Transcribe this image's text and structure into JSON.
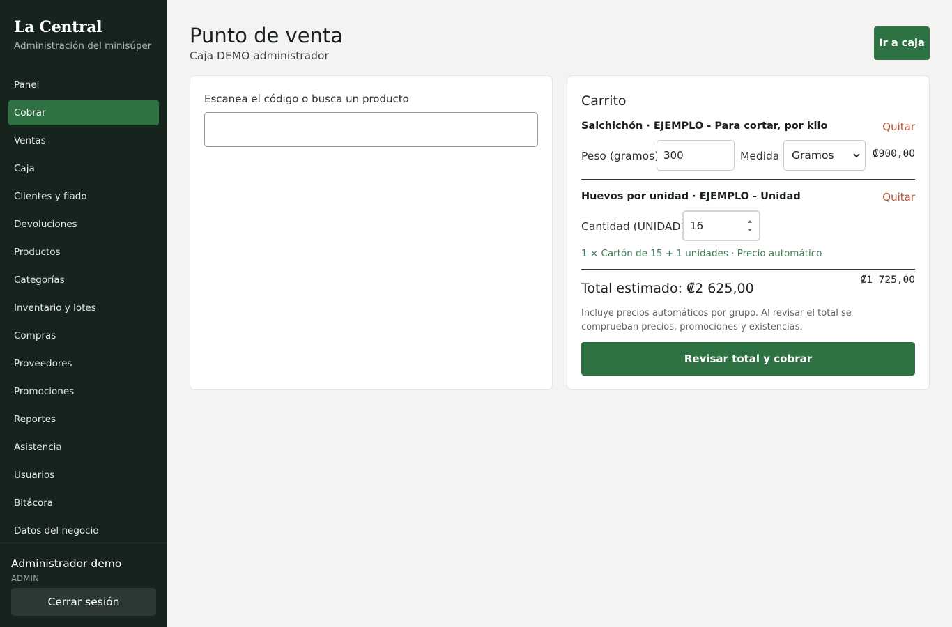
{
  "sidebar": {
    "brand": "La Central",
    "brand_sub": "Administración del minisúper",
    "items": [
      {
        "label": "Panel"
      },
      {
        "label": "Cobrar",
        "active": true
      },
      {
        "label": "Ventas"
      },
      {
        "label": "Caja"
      },
      {
        "label": "Clientes y fiado"
      },
      {
        "label": "Devoluciones"
      },
      {
        "label": "Productos"
      },
      {
        "label": "Categorías"
      },
      {
        "label": "Inventario y lotes"
      },
      {
        "label": "Compras"
      },
      {
        "label": "Proveedores"
      },
      {
        "label": "Promociones"
      },
      {
        "label": "Reportes"
      },
      {
        "label": "Asistencia"
      },
      {
        "label": "Usuarios"
      },
      {
        "label": "Bitácora"
      },
      {
        "label": "Datos del negocio"
      }
    ],
    "user": {
      "name": "Administrador demo",
      "role": "ADMIN"
    },
    "logout_label": "Cerrar sesión"
  },
  "header": {
    "title": "Punto de venta",
    "subtitle": "Caja DEMO administrador",
    "go_box_label": "Ir a caja"
  },
  "search": {
    "label": "Escanea el código o busca un producto",
    "value": ""
  },
  "cart": {
    "title": "Carrito",
    "items": [
      {
        "name": "Salchichón · EJEMPLO - Para cortar, por kilo",
        "remove_label": "Quitar",
        "weight_label": "Peso (gramos)",
        "weight_value": "300",
        "unit_label": "Medida",
        "unit_value": "Gramos",
        "price": "₡900,00"
      },
      {
        "name": "Huevos por unidad · EJEMPLO - Unidad",
        "remove_label": "Quitar",
        "qty_label": "Cantidad (UNIDAD)",
        "qty_value": "16",
        "note": "1 × Cartón de 15 + 1 unidades · Precio automático",
        "price": "₡1 725,00"
      }
    ],
    "total_label": "Total estimado: ₡2 625,00",
    "help_text": "Incluye precios automáticos por grupo. Al revisar el total se comprueban precios, promociones y existencias.",
    "checkout_label": "Revisar total y cobrar"
  },
  "colors": {
    "sidebar_bg": "#17241e",
    "accent_green": "#2e7244",
    "remove_red": "#b2502f",
    "page_bg": "#f3f4f1"
  },
  "icons": [
    "chevron-down-icon",
    "spinner-arrows-icon"
  ]
}
